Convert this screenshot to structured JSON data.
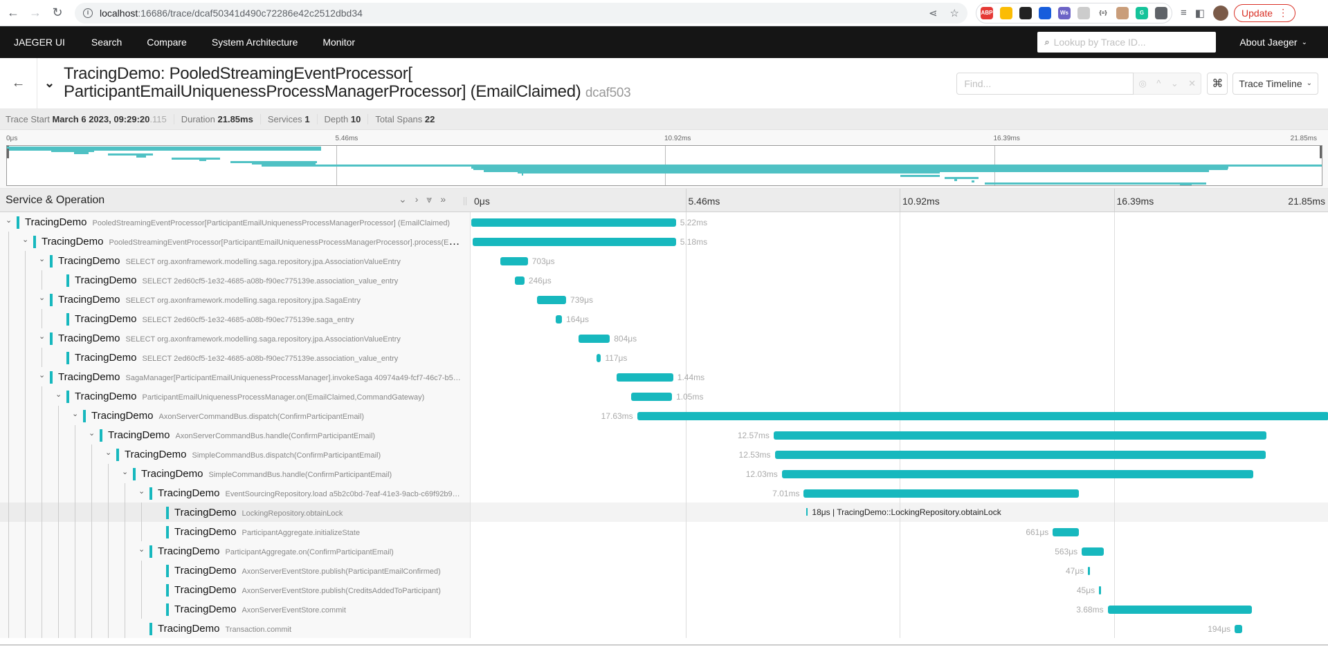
{
  "browser": {
    "url_host": "localhost",
    "url_path": ":16686/trace/dcaf50341d490c72286e42c2512dbd34",
    "update_label": "Update",
    "extensions": [
      {
        "name": "adblock-plus-icon",
        "label": "ABP",
        "color": "#e53935"
      },
      {
        "name": "keep-icon",
        "label": "",
        "color": "#fbbc04"
      },
      {
        "name": "gnome-icon",
        "label": "",
        "color": "#222222"
      },
      {
        "name": "bitwarden-icon",
        "label": "",
        "color": "#175ddc"
      },
      {
        "name": "ws-icon",
        "label": "Ws",
        "color": "#6c63c6"
      },
      {
        "name": "target-icon",
        "label": "",
        "color": "#cccccc"
      },
      {
        "name": "json-icon",
        "label": "{≡}",
        "color": "#ffffff"
      },
      {
        "name": "glasses-icon",
        "label": "",
        "color": "#c99d7a"
      },
      {
        "name": "grammarly-icon",
        "label": "G",
        "color": "#15c39a"
      },
      {
        "name": "puzzle-icon",
        "label": "",
        "color": "#5f6368"
      }
    ]
  },
  "topnav": {
    "brand": "JAEGER UI",
    "items": [
      "Search",
      "Compare",
      "System Architecture",
      "Monitor"
    ],
    "lookup_placeholder": "Lookup by Trace ID...",
    "about": "About Jaeger"
  },
  "header": {
    "title_line1": "TracingDemo: PooledStreamingEventProcessor[",
    "title_line2": "ParticipantEmailUniquenessProcessManagerProcessor] (EmailClaimed)",
    "trace_id_short": "dcaf503",
    "find_placeholder": "Find...",
    "view_select": "Trace Timeline"
  },
  "summary": {
    "trace_start_label": "Trace Start",
    "trace_start_value": "March 6 2023, 09:29:20",
    "trace_start_ms": ".115",
    "duration_label": "Duration",
    "duration_value": "21.85ms",
    "services_label": "Services",
    "services_value": "1",
    "depth_label": "Depth",
    "depth_value": "10",
    "total_spans_label": "Total Spans",
    "total_spans_value": "22"
  },
  "timeline": {
    "total_ms": 21.85,
    "ticks": [
      "0μs",
      "5.46ms",
      "10.92ms",
      "16.39ms",
      "21.85ms"
    ],
    "column_header": "Service & Operation",
    "accent": "#17b8be"
  },
  "spans": [
    {
      "depth": 0,
      "hasChildren": true,
      "service": "TracingDemo",
      "op": "PooledStreamingEventProcessor[ParticipantEmailUniquenessProcessManagerProcessor] (EmailClaimed)",
      "start_ms": 0.0,
      "dur_ms": 5.22,
      "dur_label": "5.22ms"
    },
    {
      "depth": 1,
      "hasChildren": true,
      "service": "TracingDemo",
      "op": "PooledStreamingEventProcessor[ParticipantEmailUniquenessProcessManagerProcessor].process(EmailClaimed)",
      "start_ms": 0.04,
      "dur_ms": 5.18,
      "dur_label": "5.18ms"
    },
    {
      "depth": 2,
      "hasChildren": true,
      "service": "TracingDemo",
      "op": "SELECT org.axonframework.modelling.saga.repository.jpa.AssociationValueEntry",
      "start_ms": 0.74,
      "dur_ms": 0.703,
      "dur_label": "703μs"
    },
    {
      "depth": 3,
      "hasChildren": false,
      "service": "TracingDemo",
      "op": "SELECT 2ed60cf5-1e32-4685-a08b-f90ec775139e.association_value_entry",
      "start_ms": 1.11,
      "dur_ms": 0.246,
      "dur_label": "246μs"
    },
    {
      "depth": 2,
      "hasChildren": true,
      "service": "TracingDemo",
      "op": "SELECT org.axonframework.modelling.saga.repository.jpa.SagaEntry",
      "start_ms": 1.68,
      "dur_ms": 0.739,
      "dur_label": "739μs"
    },
    {
      "depth": 3,
      "hasChildren": false,
      "service": "TracingDemo",
      "op": "SELECT 2ed60cf5-1e32-4685-a08b-f90ec775139e.saga_entry",
      "start_ms": 2.15,
      "dur_ms": 0.164,
      "dur_label": "164μs"
    },
    {
      "depth": 2,
      "hasChildren": true,
      "service": "TracingDemo",
      "op": "SELECT org.axonframework.modelling.saga.repository.jpa.AssociationValueEntry",
      "start_ms": 2.73,
      "dur_ms": 0.804,
      "dur_label": "804μs"
    },
    {
      "depth": 3,
      "hasChildren": false,
      "service": "TracingDemo",
      "op": "SELECT 2ed60cf5-1e32-4685-a08b-f90ec775139e.association_value_entry",
      "start_ms": 3.19,
      "dur_ms": 0.117,
      "dur_label": "117μs"
    },
    {
      "depth": 2,
      "hasChildren": true,
      "service": "TracingDemo",
      "op": "SagaManager[ParticipantEmailUniquenessProcessManager].invokeSaga 40974a49-fcf7-46c7-b5…",
      "start_ms": 3.71,
      "dur_ms": 1.44,
      "dur_label": "1.44ms"
    },
    {
      "depth": 3,
      "hasChildren": true,
      "service": "TracingDemo",
      "op": "ParticipantEmailUniquenessProcessManager.on(EmailClaimed,CommandGateway)",
      "start_ms": 4.07,
      "dur_ms": 1.05,
      "dur_label": "1.05ms"
    },
    {
      "depth": 4,
      "hasChildren": true,
      "service": "TracingDemo",
      "op": "AxonServerCommandBus.dispatch(ConfirmParticipantEmail)",
      "start_ms": 4.23,
      "dur_ms": 17.63,
      "dur_label": "17.63ms"
    },
    {
      "depth": 5,
      "hasChildren": true,
      "service": "TracingDemo",
      "op": "AxonServerCommandBus.handle(ConfirmParticipantEmail)",
      "start_ms": 7.71,
      "dur_ms": 12.57,
      "dur_label": "12.57ms"
    },
    {
      "depth": 6,
      "hasChildren": true,
      "service": "TracingDemo",
      "op": "SimpleCommandBus.dispatch(ConfirmParticipantEmail)",
      "start_ms": 7.74,
      "dur_ms": 12.53,
      "dur_label": "12.53ms"
    },
    {
      "depth": 7,
      "hasChildren": true,
      "service": "TracingDemo",
      "op": "SimpleCommandBus.handle(ConfirmParticipantEmail)",
      "start_ms": 7.92,
      "dur_ms": 12.03,
      "dur_label": "12.03ms"
    },
    {
      "depth": 8,
      "hasChildren": true,
      "service": "TracingDemo",
      "op": "EventSourcingRepository.load a5b2c0bd-7eaf-41e3-9acb-c69f92b9…",
      "start_ms": 8.48,
      "dur_ms": 7.01,
      "dur_label": "7.01ms"
    },
    {
      "depth": 9,
      "hasChildren": false,
      "service": "TracingDemo",
      "op": "LockingRepository.obtainLock",
      "start_ms": 8.55,
      "dur_ms": 0.018,
      "dur_label": "18μs",
      "hovered": true,
      "hover_label": "18μs | TracingDemo::LockingRepository.obtainLock"
    },
    {
      "depth": 9,
      "hasChildren": false,
      "service": "TracingDemo",
      "op": "ParticipantAggregate.initializeState",
      "start_ms": 14.83,
      "dur_ms": 0.661,
      "dur_label": "661μs"
    },
    {
      "depth": 8,
      "hasChildren": true,
      "service": "TracingDemo",
      "op": "ParticipantAggregate.on(ConfirmParticipantEmail)",
      "start_ms": 15.57,
      "dur_ms": 0.563,
      "dur_label": "563μs"
    },
    {
      "depth": 9,
      "hasChildren": false,
      "service": "TracingDemo",
      "op": "AxonServerEventStore.publish(ParticipantEmailConfirmed)",
      "start_ms": 15.73,
      "dur_ms": 0.047,
      "dur_label": "47μs"
    },
    {
      "depth": 9,
      "hasChildren": false,
      "service": "TracingDemo",
      "op": "AxonServerEventStore.publish(CreditsAddedToParticipant)",
      "start_ms": 16.01,
      "dur_ms": 0.045,
      "dur_label": "45μs"
    },
    {
      "depth": 9,
      "hasChildren": false,
      "service": "TracingDemo",
      "op": "AxonServerEventStore.commit",
      "start_ms": 16.23,
      "dur_ms": 3.68,
      "dur_label": "3.68ms"
    },
    {
      "depth": 8,
      "hasChildren": false,
      "service": "TracingDemo",
      "op": "Transaction.commit",
      "start_ms": 19.47,
      "dur_ms": 0.194,
      "dur_label": "194μs"
    }
  ]
}
